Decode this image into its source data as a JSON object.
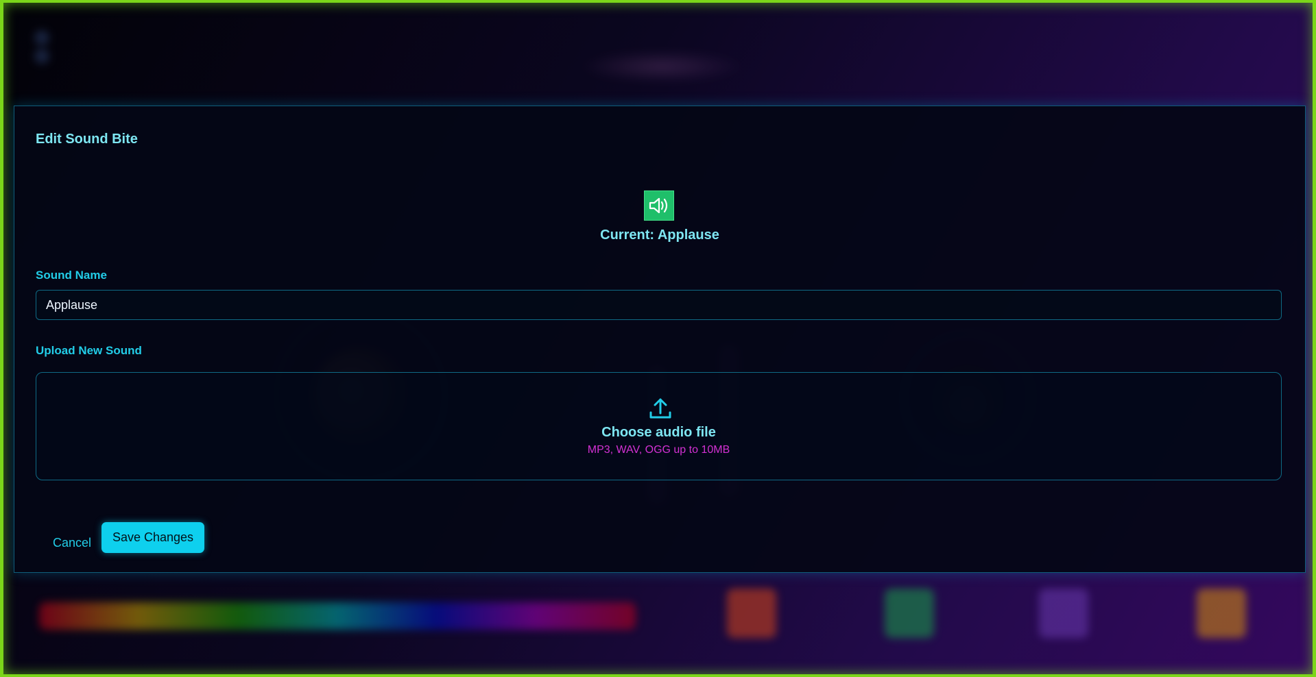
{
  "modal": {
    "title": "Edit Sound Bite",
    "current_label": "Current: Applause",
    "current_icon": "speaker-volume-icon",
    "name_label": "Sound Name",
    "name_value": "Applause",
    "upload_label": "Upload New Sound",
    "upload_icon": "upload-icon",
    "upload_title": "Choose audio file",
    "upload_hint": "MP3, WAV, OGG up to 10MB",
    "cancel_label": "Cancel",
    "save_label": "Save Changes"
  },
  "colors": {
    "accent": "#0ed0ee",
    "label": "#22cde8",
    "heading": "#7ee6f2",
    "hint": "#d431d4",
    "sound_icon_bg": "#1fbf6a",
    "frame_border": "#7bd61a"
  }
}
